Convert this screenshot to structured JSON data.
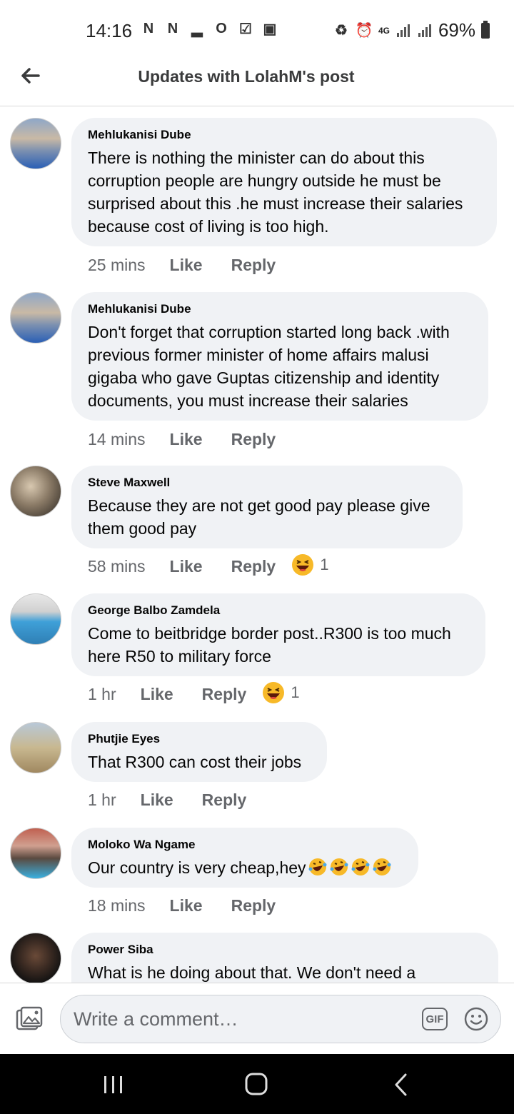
{
  "status_bar": {
    "time": "14:16",
    "battery": "69%",
    "network": "4G"
  },
  "header": {
    "title": "Updates with LolahM's post"
  },
  "comments": [
    {
      "author": "Mehlukanisi Dube",
      "text": "There is nothing the minister can do about this corruption people are hungry outside he must be surprised about this .he must increase their salaries because cost of living is too high.",
      "time": "25 mins",
      "like": "Like",
      "reply": "Reply"
    },
    {
      "author": "Mehlukanisi Dube",
      "text": "Don't forget that corruption started long back .with previous former minister of home affairs malusi gigaba who gave Guptas citizenship and identity documents, you must increase their salaries",
      "time": "14 mins",
      "like": "Like",
      "reply": "Reply"
    },
    {
      "author": "Steve Maxwell",
      "text": "Because they are not get  good pay please give them good pay",
      "time": "58 mins",
      "like": "Like",
      "reply": "Reply",
      "reaction_count": "1"
    },
    {
      "author": "George Balbo Zamdela",
      "text": "Come to beitbridge border post..R300 is too much here R50 to military force",
      "time": "1 hr",
      "like": "Like",
      "reply": "Reply",
      "reaction_count": "1"
    },
    {
      "author": "Phutjie Eyes",
      "text": "That R300 can cost their jobs",
      "time": "1 hr",
      "like": "Like",
      "reply": "Reply"
    },
    {
      "author": "Moloko Wa Ngame",
      "text": "Our country is very cheap,hey",
      "time": "18 mins",
      "like": "Like",
      "reply": "Reply"
    },
    {
      "author": "Power Siba",
      "text": "What is he doing about that. We don't need a"
    }
  ],
  "composer": {
    "placeholder": "Write a comment…",
    "gif_label": "GIF"
  },
  "icons": {
    "back": "back-arrow-icon",
    "reaction": "haha-reaction-icon",
    "photo": "photo-icon",
    "emoji": "emoji-icon"
  }
}
